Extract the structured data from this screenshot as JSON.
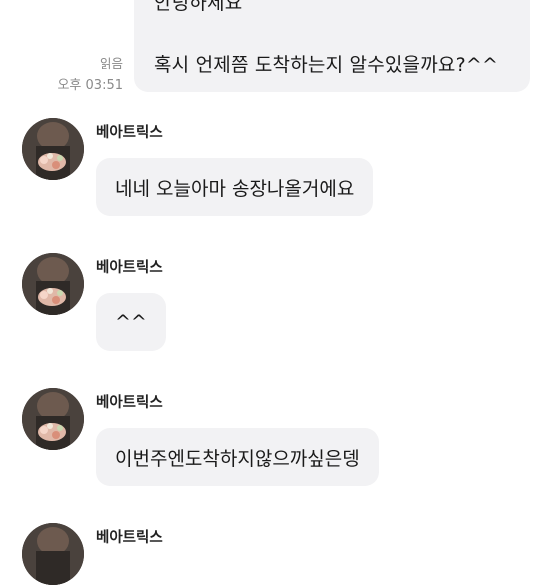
{
  "outgoing": {
    "lines": [
      "안녕하세요",
      "혹시 언제쯤 도착하는지 알수있을까요?^^"
    ],
    "read_status": "읽음",
    "time": "오후 03:51"
  },
  "messages": [
    {
      "sender": "베아트릭스",
      "text": "네네 오늘아마 송장나올거에요"
    },
    {
      "sender": "베아트릭스",
      "text": "^^"
    },
    {
      "sender": "베아트릭스",
      "text": "이번주엔도착하지않으까싶은뎅"
    },
    {
      "sender": "베아트릭스",
      "text": ""
    }
  ],
  "colors": {
    "bubble": "#f2f2f4",
    "meta_text": "#8a8a8a",
    "background": "#ffffff"
  }
}
